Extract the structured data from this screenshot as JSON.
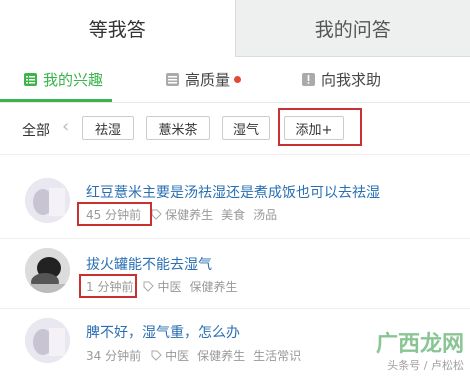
{
  "top_tabs": [
    "等我答",
    "我的问答"
  ],
  "sub_tabs": {
    "interest": "我的兴趣",
    "quality": "高质量",
    "help": "向我求助"
  },
  "filter": {
    "all": "全部",
    "chips": [
      "祛湿",
      "薏米茶",
      "湿气",
      "添加+"
    ]
  },
  "questions": [
    {
      "title": "红豆薏米主要是汤祛湿还是煮成饭也可以去祛湿",
      "time": "45 分钟前",
      "tags": [
        "保健养生",
        "美食",
        "汤品"
      ]
    },
    {
      "title": "拔火罐能不能去湿气",
      "time": "1 分钟前",
      "tags": [
        "中医",
        "保健养生"
      ]
    },
    {
      "title": "脾不好，湿气重，怎么办",
      "time": "34 分钟前",
      "tags": [
        "中医",
        "保健养生",
        "生活常识"
      ]
    }
  ],
  "watermark": {
    "logo_text": "广西龙网",
    "sub_text": "头条号 / 卢松松"
  },
  "colors": {
    "accent": "#39b54a",
    "link": "#2a6fb3",
    "highlight": "#c7312f"
  }
}
